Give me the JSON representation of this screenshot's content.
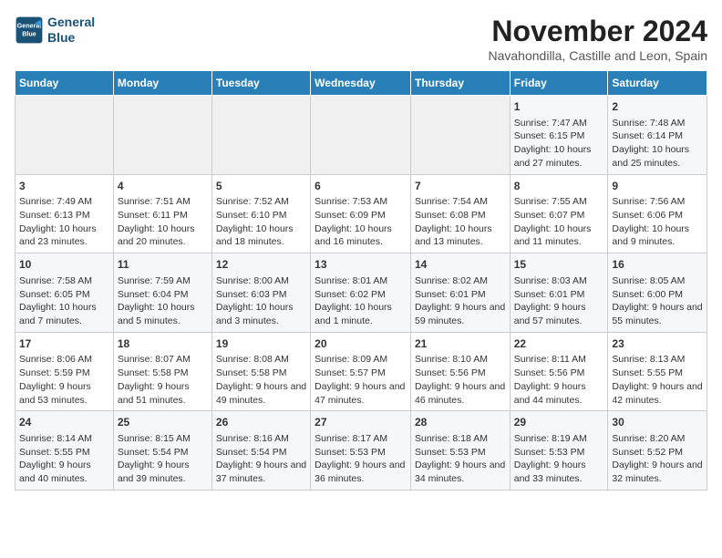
{
  "logo": {
    "line1": "General",
    "line2": "Blue"
  },
  "title": "November 2024",
  "subtitle": "Navahondilla, Castille and Leon, Spain",
  "weekdays": [
    "Sunday",
    "Monday",
    "Tuesday",
    "Wednesday",
    "Thursday",
    "Friday",
    "Saturday"
  ],
  "weeks": [
    [
      {
        "day": "",
        "content": ""
      },
      {
        "day": "",
        "content": ""
      },
      {
        "day": "",
        "content": ""
      },
      {
        "day": "",
        "content": ""
      },
      {
        "day": "",
        "content": ""
      },
      {
        "day": "1",
        "content": "Sunrise: 7:47 AM\nSunset: 6:15 PM\nDaylight: 10 hours and 27 minutes."
      },
      {
        "day": "2",
        "content": "Sunrise: 7:48 AM\nSunset: 6:14 PM\nDaylight: 10 hours and 25 minutes."
      }
    ],
    [
      {
        "day": "3",
        "content": "Sunrise: 7:49 AM\nSunset: 6:13 PM\nDaylight: 10 hours and 23 minutes."
      },
      {
        "day": "4",
        "content": "Sunrise: 7:51 AM\nSunset: 6:11 PM\nDaylight: 10 hours and 20 minutes."
      },
      {
        "day": "5",
        "content": "Sunrise: 7:52 AM\nSunset: 6:10 PM\nDaylight: 10 hours and 18 minutes."
      },
      {
        "day": "6",
        "content": "Sunrise: 7:53 AM\nSunset: 6:09 PM\nDaylight: 10 hours and 16 minutes."
      },
      {
        "day": "7",
        "content": "Sunrise: 7:54 AM\nSunset: 6:08 PM\nDaylight: 10 hours and 13 minutes."
      },
      {
        "day": "8",
        "content": "Sunrise: 7:55 AM\nSunset: 6:07 PM\nDaylight: 10 hours and 11 minutes."
      },
      {
        "day": "9",
        "content": "Sunrise: 7:56 AM\nSunset: 6:06 PM\nDaylight: 10 hours and 9 minutes."
      }
    ],
    [
      {
        "day": "10",
        "content": "Sunrise: 7:58 AM\nSunset: 6:05 PM\nDaylight: 10 hours and 7 minutes."
      },
      {
        "day": "11",
        "content": "Sunrise: 7:59 AM\nSunset: 6:04 PM\nDaylight: 10 hours and 5 minutes."
      },
      {
        "day": "12",
        "content": "Sunrise: 8:00 AM\nSunset: 6:03 PM\nDaylight: 10 hours and 3 minutes."
      },
      {
        "day": "13",
        "content": "Sunrise: 8:01 AM\nSunset: 6:02 PM\nDaylight: 10 hours and 1 minute."
      },
      {
        "day": "14",
        "content": "Sunrise: 8:02 AM\nSunset: 6:01 PM\nDaylight: 9 hours and 59 minutes."
      },
      {
        "day": "15",
        "content": "Sunrise: 8:03 AM\nSunset: 6:01 PM\nDaylight: 9 hours and 57 minutes."
      },
      {
        "day": "16",
        "content": "Sunrise: 8:05 AM\nSunset: 6:00 PM\nDaylight: 9 hours and 55 minutes."
      }
    ],
    [
      {
        "day": "17",
        "content": "Sunrise: 8:06 AM\nSunset: 5:59 PM\nDaylight: 9 hours and 53 minutes."
      },
      {
        "day": "18",
        "content": "Sunrise: 8:07 AM\nSunset: 5:58 PM\nDaylight: 9 hours and 51 minutes."
      },
      {
        "day": "19",
        "content": "Sunrise: 8:08 AM\nSunset: 5:58 PM\nDaylight: 9 hours and 49 minutes."
      },
      {
        "day": "20",
        "content": "Sunrise: 8:09 AM\nSunset: 5:57 PM\nDaylight: 9 hours and 47 minutes."
      },
      {
        "day": "21",
        "content": "Sunrise: 8:10 AM\nSunset: 5:56 PM\nDaylight: 9 hours and 46 minutes."
      },
      {
        "day": "22",
        "content": "Sunrise: 8:11 AM\nSunset: 5:56 PM\nDaylight: 9 hours and 44 minutes."
      },
      {
        "day": "23",
        "content": "Sunrise: 8:13 AM\nSunset: 5:55 PM\nDaylight: 9 hours and 42 minutes."
      }
    ],
    [
      {
        "day": "24",
        "content": "Sunrise: 8:14 AM\nSunset: 5:55 PM\nDaylight: 9 hours and 40 minutes."
      },
      {
        "day": "25",
        "content": "Sunrise: 8:15 AM\nSunset: 5:54 PM\nDaylight: 9 hours and 39 minutes."
      },
      {
        "day": "26",
        "content": "Sunrise: 8:16 AM\nSunset: 5:54 PM\nDaylight: 9 hours and 37 minutes."
      },
      {
        "day": "27",
        "content": "Sunrise: 8:17 AM\nSunset: 5:53 PM\nDaylight: 9 hours and 36 minutes."
      },
      {
        "day": "28",
        "content": "Sunrise: 8:18 AM\nSunset: 5:53 PM\nDaylight: 9 hours and 34 minutes."
      },
      {
        "day": "29",
        "content": "Sunrise: 8:19 AM\nSunset: 5:53 PM\nDaylight: 9 hours and 33 minutes."
      },
      {
        "day": "30",
        "content": "Sunrise: 8:20 AM\nSunset: 5:52 PM\nDaylight: 9 hours and 32 minutes."
      }
    ]
  ],
  "accent_color": "#2980b9"
}
